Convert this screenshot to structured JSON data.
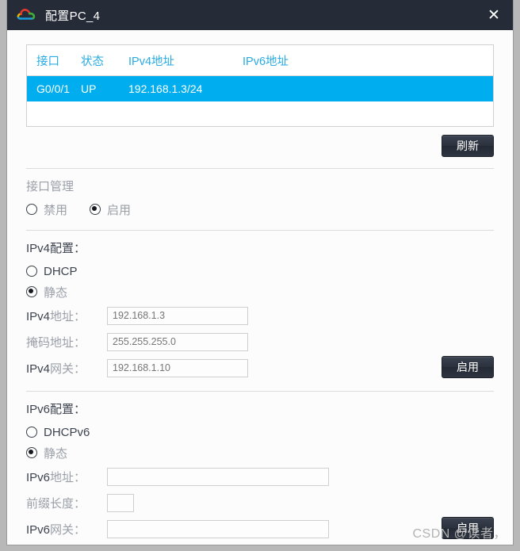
{
  "window": {
    "title": "配置PC_4",
    "app_icon": "cloud-icon",
    "close_label": "✕"
  },
  "interface_table": {
    "columns": [
      "接口",
      "状态",
      "IPv4地址",
      "IPv6地址"
    ],
    "rows": [
      {
        "interface": "G0/0/1",
        "state": "UP",
        "ipv4": "192.168.1.3/24",
        "ipv6": "",
        "selected": true
      }
    ],
    "selected_row_color": "#00aeef",
    "header_color": "#29abe2",
    "refresh_label": "刷新"
  },
  "interface_admin": {
    "title": "接口管理",
    "options": [
      {
        "label": "禁用",
        "selected": false
      },
      {
        "label": "启用",
        "selected": true
      }
    ]
  },
  "ipv4": {
    "title": "IPv4配置：",
    "mode_options": [
      {
        "label": "DHCP",
        "selected": false
      },
      {
        "label": "静态",
        "selected": true
      }
    ],
    "fields": [
      {
        "label": "IPv4地址：",
        "label_latin": "IPv4",
        "label_cjk": "地址：",
        "value": "192.168.1.3",
        "placeholder": ""
      },
      {
        "label": "掩码地址：",
        "label_latin": "",
        "label_cjk": "掩码地址：",
        "value": "255.255.255.0",
        "placeholder": ""
      },
      {
        "label": "IPv4网关：",
        "label_latin": "IPv4",
        "label_cjk": "网关：",
        "value": "192.168.1.10",
        "placeholder": ""
      }
    ],
    "apply_label": "启用"
  },
  "ipv6": {
    "title": "IPv6配置：",
    "mode_options": [
      {
        "label": "DHCPv6",
        "selected": false
      },
      {
        "label": "静态",
        "selected": true
      }
    ],
    "fields": [
      {
        "label": "IPv6地址：",
        "label_latin": "IPv6",
        "label_cjk": "地址：",
        "value": "",
        "placeholder": ""
      },
      {
        "label": "前缀长度：",
        "label_latin": "",
        "label_cjk": "前缀长度：",
        "value": "",
        "placeholder": ""
      },
      {
        "label": "IPv6网关：",
        "label_latin": "IPv6",
        "label_cjk": "网关：",
        "value": "",
        "placeholder": ""
      }
    ],
    "apply_label": "启用"
  },
  "watermark": "CSDN @读者，"
}
